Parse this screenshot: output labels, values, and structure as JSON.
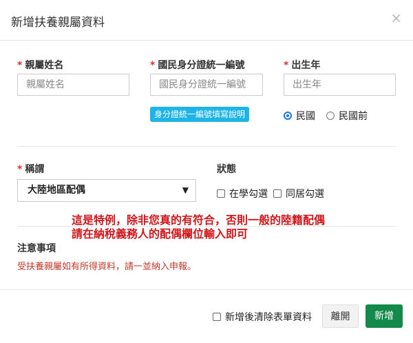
{
  "dialog": {
    "title": "新增扶養親屬資料",
    "close": "×"
  },
  "fields": {
    "name": {
      "label": "親屬姓名",
      "placeholder": "親屬姓名"
    },
    "id": {
      "label": "國民身分證統一編號",
      "placeholder": "國民身分證統一編號",
      "help_button": "身分證統一編號填寫說明"
    },
    "birth_year": {
      "label": "出生年",
      "placeholder": "出生年",
      "era_options": [
        "民國",
        "民國前"
      ],
      "era_selected": "民國"
    },
    "relation": {
      "label": "稱謂",
      "value": "大陸地區配偶"
    },
    "status": {
      "label": "狀態",
      "options": [
        "在學勾選",
        "同居勾選"
      ]
    }
  },
  "annotation": [
    "這是特例，除非您真的有符合，否則一般的陸籍配偶",
    "請在納稅義務人的配偶欄位輸入即可"
  ],
  "notes": {
    "title": "注意事項",
    "text": "受扶養親屬如有所得資料，請一並納入申報。"
  },
  "footer": {
    "clear_after_add": "新增後清除表單資料",
    "leave": "離開",
    "add": "新增"
  },
  "colors": {
    "required": "#d9342b",
    "help": "#1eb4e6",
    "primary": "#148a4a"
  }
}
